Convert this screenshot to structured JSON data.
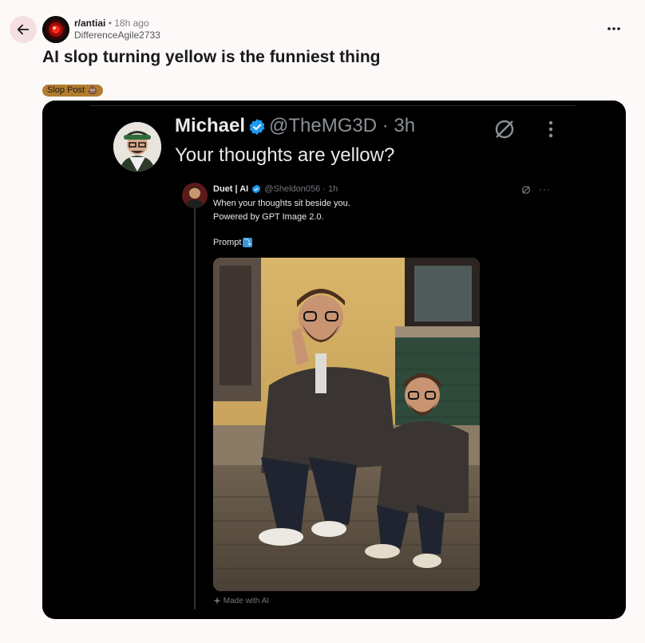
{
  "post": {
    "subreddit": "r/antiai",
    "separator": "•",
    "time": "18h ago",
    "author": "DifferenceAgile2733",
    "title": "AI slop turning yellow is the funniest thing",
    "flair": "Slop Post 💩"
  },
  "tweet": {
    "name": "Michael",
    "handle": "@TheMG3D · 3h",
    "text": "Your thoughts are yellow?",
    "more": "⋮"
  },
  "quote": {
    "name": "Duet | AI",
    "handle": "@Sheldon056 · 1h",
    "more": "···",
    "line1": "When your thoughts sit beside you.",
    "line2": "Powered by GPT Image 2.0.",
    "prompt_label": "Prompt",
    "prompt_emoji": "⤵",
    "made_with": "Made with AI"
  },
  "colors": {
    "accent_back": "#f6dfe0",
    "flair_bg": "#b27c2e",
    "verified": "#1d9bf0"
  },
  "icons": {
    "back": "arrow-left-icon",
    "more": "ellipsis-icon",
    "verified": "verified-badge-icon",
    "grok": "grok-icon",
    "sparkle": "sparkle-icon"
  }
}
